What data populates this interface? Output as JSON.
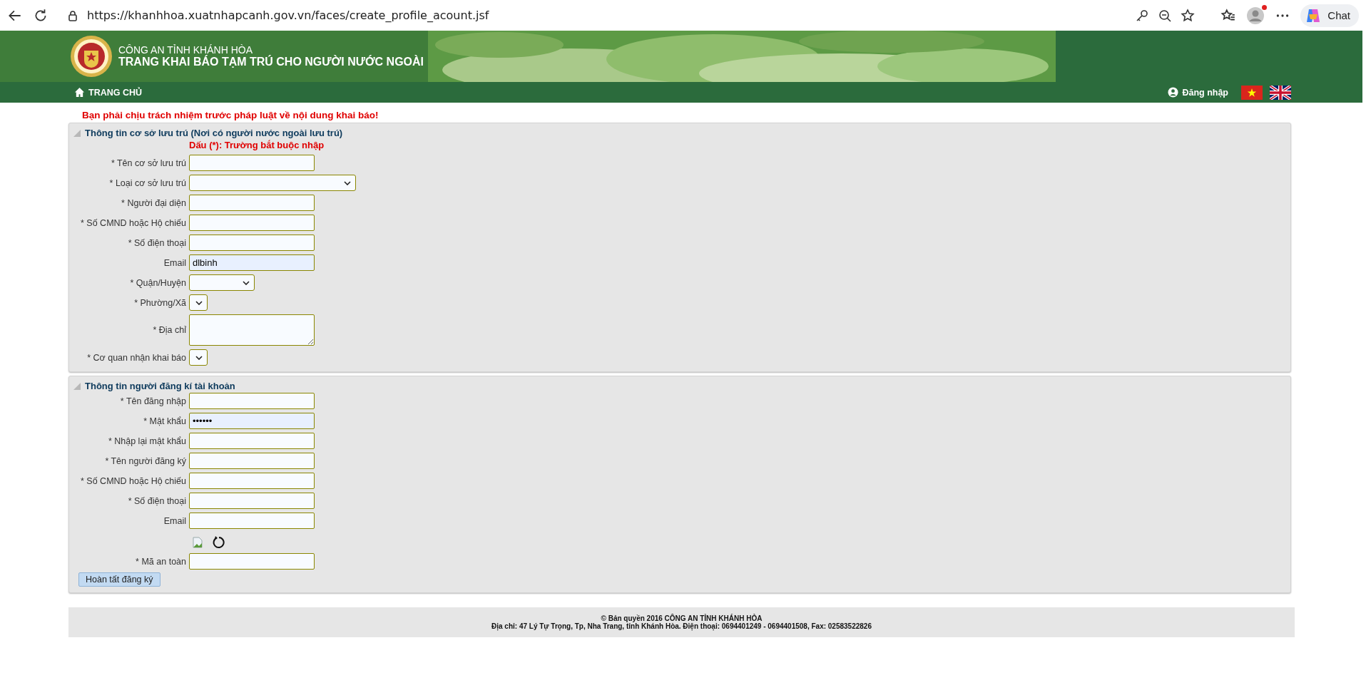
{
  "browser": {
    "url": "https://khanhhoa.xuatnhapcanh.gov.vn/faces/create_profile_acount.jsf",
    "chat_label": "Chat",
    "notification": true
  },
  "header": {
    "org": "CÔNG AN TỈNH KHÁNH HÒA",
    "title": "TRANG KHAI BÁO TẠM TRÚ CHO NGƯỜI NƯỚC NGOÀI",
    "nav_home": "TRANG CHỦ",
    "login": "Đăng nhập"
  },
  "warning": "Bạn phải chịu trách nhiệm trước pháp luật về nội dung khai báo!",
  "sections": [
    {
      "title": "Thông tin cơ sở lưu trú (Nơi có người nước ngoài lưu trú)",
      "note": "Dấu (*): Trường bắt buộc nhập",
      "fields": [
        {
          "kind": "text",
          "label": "* Tên cơ sở lưu trú"
        },
        {
          "kind": "wideselect",
          "label": "* Loại cơ sở lưu trú"
        },
        {
          "kind": "text",
          "label": "* Người đại diện"
        },
        {
          "kind": "text",
          "label": "* Số CMND hoặc Hộ chiếu"
        },
        {
          "kind": "text",
          "label": "* Số điện thoại"
        },
        {
          "kind": "text",
          "label": "Email",
          "value": "dlbinh",
          "autofilled": true
        },
        {
          "kind": "select",
          "label": "* Quận/Huyện"
        },
        {
          "kind": "miniselect",
          "label": "* Phường/Xã"
        },
        {
          "kind": "textarea",
          "label": "* Địa chỉ"
        },
        {
          "kind": "miniselect",
          "label": "* Cơ quan nhận khai báo"
        }
      ]
    },
    {
      "title": "Thông tin người đăng kí tài khoản",
      "fields": [
        {
          "kind": "text",
          "label": "* Tên đăng nhập"
        },
        {
          "kind": "text",
          "label": "* Mật khẩu",
          "value": "••••••",
          "autofilled": true
        },
        {
          "kind": "text",
          "label": "* Nhập lại mật khẩu"
        },
        {
          "kind": "text",
          "label": "* Tên người đăng ký"
        },
        {
          "kind": "text",
          "label": "* Số CMND hoặc Hộ chiếu"
        },
        {
          "kind": "text",
          "label": "* Số điện thoại"
        },
        {
          "kind": "text",
          "label": "Email"
        },
        {
          "kind": "captcha"
        },
        {
          "kind": "text",
          "label": "* Mã an toàn"
        }
      ],
      "button": "Hoàn tất đăng ký"
    }
  ],
  "footer": [
    "© Bản quyền 2016 CÔNG AN TỈNH KHÁNH HÒA",
    "Địa chỉ: 47 Lý Tự Trọng, Tp, Nha Trang, tỉnh Khánh Hòa. Điện thoại: 0694401249 - 0694401508, Fax: 02583522826"
  ]
}
